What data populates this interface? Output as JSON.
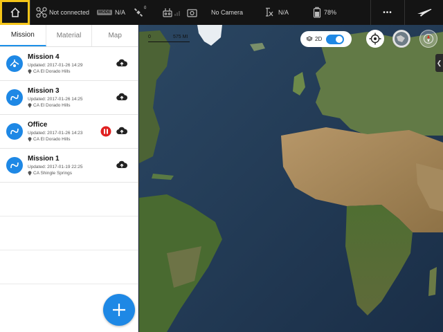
{
  "topbar": {
    "connection_status": "Not connected",
    "mode_badge": "MODE",
    "mode_value": "N/A",
    "gps_count": "0",
    "camera_status": "No Camera",
    "vision_value": "N/A",
    "battery": "78%",
    "more_label": "•••"
  },
  "tabs": [
    {
      "label": "Mission",
      "active": true
    },
    {
      "label": "Material",
      "active": false
    },
    {
      "label": "Map",
      "active": false
    }
  ],
  "missions": [
    {
      "title": "Mission 4",
      "updated": "Updated: 2017-01-26 14:29",
      "location": "CA El Dorado Hills"
    },
    {
      "title": "Mission 3",
      "updated": "Updated: 2017-01-26 14:25",
      "location": "CA El Dorado Hills"
    },
    {
      "title": "Office",
      "updated": "Updated: 2017-01-26 14:23",
      "location": "CA El Dorado Hills"
    },
    {
      "title": "Mission 1",
      "updated": "Updated: 2017-01-19 22:25",
      "location": "CA Shingle Springs"
    }
  ],
  "map": {
    "scale_zero": "0",
    "scale_label": "575 MI",
    "view_mode": "2D"
  },
  "colors": {
    "accent": "#1e88e5",
    "highlight": "#f5c518",
    "pause": "#e02020",
    "topbar": "#141414"
  }
}
